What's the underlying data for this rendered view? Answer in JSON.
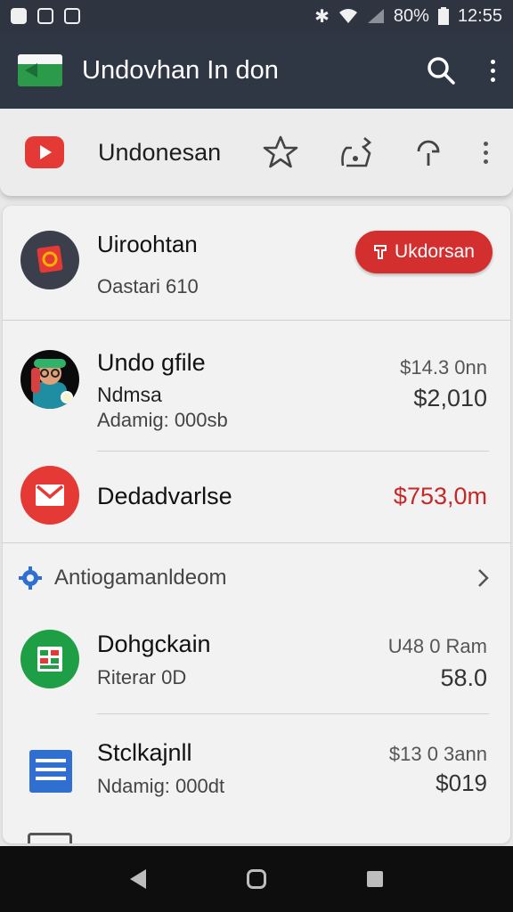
{
  "status_bar": {
    "battery": "80%",
    "time": "12:55",
    "icons": [
      "notification-icon",
      "notification-icon",
      "notification-icon",
      "bluetooth-icon",
      "wifi-icon",
      "signal-icon",
      "battery-icon"
    ]
  },
  "app_bar": {
    "title": "Undovhan In don",
    "icons": [
      "flag-icon",
      "search-icon",
      "more-vert-icon"
    ]
  },
  "toolbar": {
    "title": "Undonesan",
    "icons": [
      "youtube-icon",
      "star-icon",
      "share-icon",
      "sync-icon",
      "more-vert-icon"
    ]
  },
  "header_item": {
    "title": "Uiroohtan",
    "subtitle": "Oastari 610",
    "button_label": "Ukdorsan"
  },
  "items": [
    {
      "title": "Undo gfile",
      "line2": "Ndmsa",
      "line3": "Adamig: 000sb",
      "amount1": "$14.3 0nn",
      "amount2": "$2,010"
    },
    {
      "title": "Dedadvarlse",
      "amount": "$753,0m"
    }
  ],
  "section": {
    "title": "Antiogamanldeom"
  },
  "items_after_section": [
    {
      "title": "Dohgckain",
      "subtitle": "Riterar 0D",
      "amount1": "U48 0 Ram",
      "amount2": "58.0"
    },
    {
      "title": "Stclkajnll",
      "subtitle": "Ndamig: 000dt",
      "amount1": "$13 0 3ann",
      "amount2": "$019"
    }
  ],
  "colors": {
    "app_bar": "#2f3745",
    "accent_red": "#d32f2f",
    "gmail_red": "#e53935",
    "sheets_green": "#1e9e45",
    "docs_blue": "#2f6fcf"
  }
}
